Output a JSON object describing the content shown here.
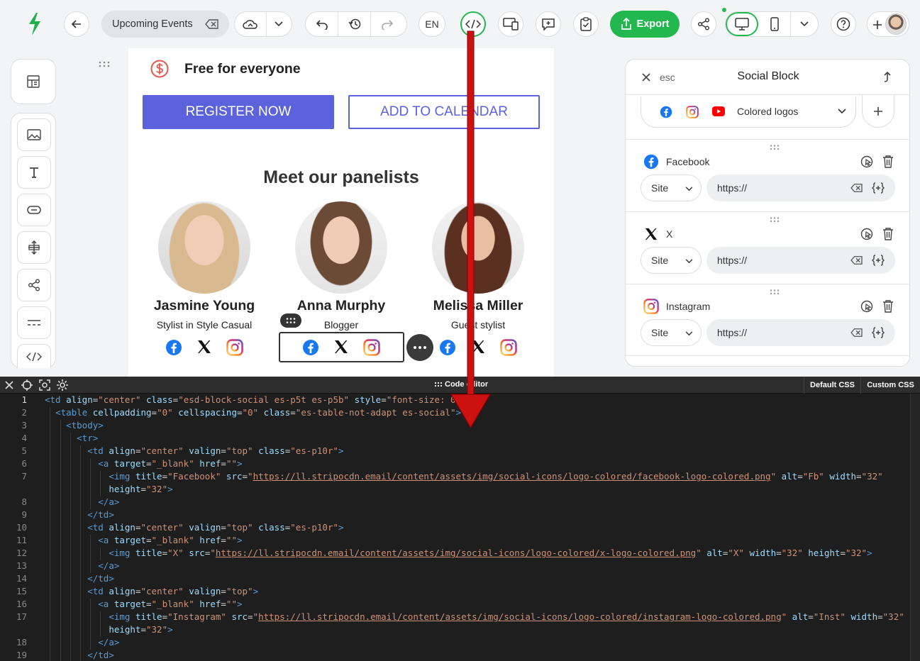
{
  "toolbar": {
    "doc_title": "Upcoming Events",
    "lang": "EN",
    "export_label": "Export"
  },
  "email": {
    "free_text": "Free for everyone",
    "register_label": "REGISTER NOW",
    "calendar_label": "ADD TO CALENDAR",
    "panel_heading": "Meet our panelists",
    "panelists": [
      {
        "name": "Jasmine Young",
        "role": "Stylist in Style Casual"
      },
      {
        "name": "Anna Murphy",
        "role": "Blogger"
      },
      {
        "name": "Melissa Miller",
        "role": "Guest stylist"
      }
    ]
  },
  "panel": {
    "esc_label": "esc",
    "title": "Social Block",
    "logo_style": "Colored logos",
    "networks": [
      {
        "name": "Facebook",
        "type": "Site",
        "url": "https://"
      },
      {
        "name": "X",
        "type": "Site",
        "url": "https://"
      },
      {
        "name": "Instagram",
        "type": "Site",
        "url": "https://"
      }
    ]
  },
  "code_editor": {
    "title": "Code editor",
    "default_css": "Default CSS",
    "custom_css": "Custom CSS",
    "line_numbers": [
      "1",
      "2",
      "3",
      "4",
      "5",
      "6",
      "7",
      "",
      "8",
      "9",
      "10",
      "11",
      "12",
      "13",
      "14",
      "15",
      "16",
      "17",
      "",
      "18",
      "19"
    ]
  },
  "colors": {
    "accent_green": "#22b84f",
    "register_bg": "#5b62dc",
    "arrow_red": "#cc1111",
    "facebook": "#1877f2",
    "youtube": "#ff0000"
  }
}
